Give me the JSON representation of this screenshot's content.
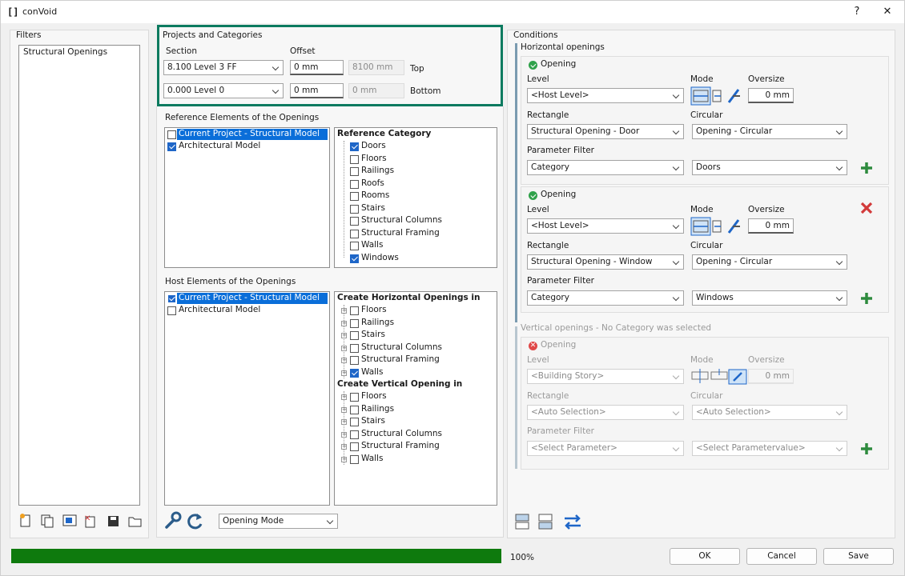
{
  "window": {
    "title": "conVoid",
    "help": "?",
    "close": "✕"
  },
  "filters": {
    "header": "Filters",
    "items": [
      "Structural Openings"
    ]
  },
  "projects": {
    "header": "Projects and Categories",
    "section_label": "Section",
    "offset_label": "Offset",
    "top_section": "8.100  Level 3 FF",
    "top_offset": "0 mm",
    "top_abs": "8100 mm",
    "top_label": "Top",
    "bottom_section": "0.000  Level 0",
    "bottom_offset": "0 mm",
    "bottom_abs": "0 mm",
    "bottom_label": "Bottom"
  },
  "reference": {
    "header": "Reference Elements of the Openings",
    "models": [
      {
        "label": "Current Project - Structural Model",
        "checked": false
      },
      {
        "label": "Architectural Model",
        "checked": true
      }
    ],
    "category_header": "Reference Category",
    "categories": [
      {
        "label": "Doors",
        "checked": true
      },
      {
        "label": "Floors",
        "checked": false
      },
      {
        "label": "Railings",
        "checked": false
      },
      {
        "label": "Roofs",
        "checked": false
      },
      {
        "label": "Rooms",
        "checked": false
      },
      {
        "label": "Stairs",
        "checked": false
      },
      {
        "label": "Structural Columns",
        "checked": false
      },
      {
        "label": "Structural Framing",
        "checked": false
      },
      {
        "label": "Walls",
        "checked": false
      },
      {
        "label": "Windows",
        "checked": true
      }
    ]
  },
  "host": {
    "header": "Host Elements of the Openings",
    "models": [
      {
        "label": "Current Project - Structural Model",
        "checked": true
      },
      {
        "label": "Architectural Model",
        "checked": false
      }
    ],
    "horizontal_header": "Create Horizontal Openings in",
    "horizontal": [
      {
        "label": "Floors",
        "checked": false
      },
      {
        "label": "Railings",
        "checked": false
      },
      {
        "label": "Stairs",
        "checked": false
      },
      {
        "label": "Structural Columns",
        "checked": false
      },
      {
        "label": "Structural Framing",
        "checked": false
      },
      {
        "label": "Walls",
        "checked": true
      }
    ],
    "vertical_header": "Create Vertical Opening in",
    "vertical": [
      {
        "label": "Floors",
        "checked": false
      },
      {
        "label": "Railings",
        "checked": false
      },
      {
        "label": "Stairs",
        "checked": false
      },
      {
        "label": "Structural Columns",
        "checked": false
      },
      {
        "label": "Structural Framing",
        "checked": false
      },
      {
        "label": "Walls",
        "checked": false
      }
    ]
  },
  "mode_select": "Opening Mode",
  "conditions": {
    "header": "Conditions",
    "horizontal_header": "Horizontal openings",
    "openings": [
      {
        "title": "Opening",
        "level_label": "Level",
        "level": "<Host Level>",
        "mode_label": "Mode",
        "oversize_label": "Oversize",
        "oversize": "0 mm",
        "rect_label": "Rectangle",
        "rect": "Structural Opening - Door",
        "circ_label": "Circular",
        "circ": "Opening - Circular",
        "pf_label": "Parameter Filter",
        "pf_param": "Category",
        "pf_value": "Doors"
      },
      {
        "title": "Opening",
        "level_label": "Level",
        "level": "<Host Level>",
        "mode_label": "Mode",
        "oversize_label": "Oversize",
        "oversize": "0 mm",
        "rect_label": "Rectangle",
        "rect": "Structural Opening - Window",
        "circ_label": "Circular",
        "circ": "Opening - Circular",
        "pf_label": "Parameter Filter",
        "pf_param": "Category",
        "pf_value": "Windows"
      }
    ],
    "vertical_header": "Vertical openings - No Category was selected",
    "vertical": {
      "title": "Opening",
      "level_label": "Level",
      "level": "<Building Story>",
      "mode_label": "Mode",
      "oversize_label": "Oversize",
      "oversize": "0 mm",
      "rect_label": "Rectangle",
      "rect": "<Auto Selection>",
      "circ_label": "Circular",
      "circ": "<Auto Selection>",
      "pf_label": "Parameter Filter",
      "pf_param": "<Select Parameter>",
      "pf_value": "<Select Parametervalue>"
    }
  },
  "progress": {
    "value": 1.0,
    "label": "100%",
    "color": "#0e7a0d"
  },
  "buttons": {
    "ok": "OK",
    "cancel": "Cancel",
    "save": "Save"
  },
  "colors": {
    "highlight_frame": "#0b7a5f",
    "accent": "#0a6ed9",
    "add": "#2e8b3e",
    "remove": "#d23a3a"
  }
}
